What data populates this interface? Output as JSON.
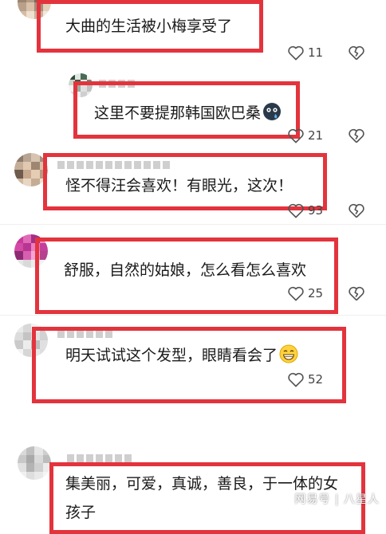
{
  "comments": [
    {
      "text": "大曲的生活被小梅享受了",
      "likes": "11"
    },
    {
      "text": "这里不要提那韩国欧巴桑",
      "likes": "21"
    },
    {
      "text": "怪不得汪会喜欢！有眼光，这次！",
      "likes": "93"
    },
    {
      "text": "舒服，自然的姑娘，怎么看怎么喜欢",
      "likes": "25"
    },
    {
      "text": "明天试试这个发型，眼睛看会了",
      "likes": "52"
    },
    {
      "text_line1": "集美丽，可爱，真诚，善良，于一体的女",
      "text_line2": "孩子"
    }
  ],
  "watermark": "网易号 | 八星人",
  "colors": {
    "highlight": "#e3343d",
    "text": "#1a1a1a",
    "meta": "#444444"
  }
}
